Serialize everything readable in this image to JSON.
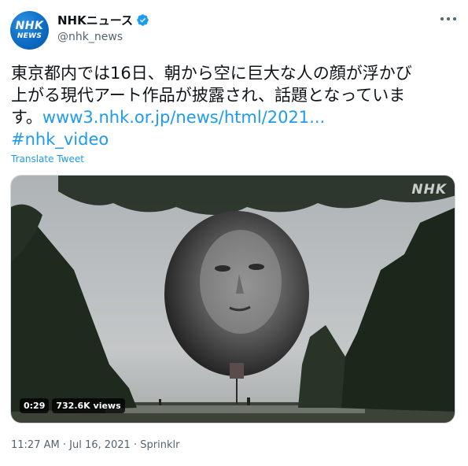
{
  "author": {
    "avatar_line1": "NHK",
    "avatar_line2": "NEWS",
    "display_name": "NHKニュース",
    "handle": "@nhk_news",
    "verified_color": "#1d9bf0"
  },
  "tweet": {
    "lines": [
      "東京都内では16日、朝から空に巨大な人の顔が浮かび",
      "上がる現代アート作品が披露され、話題となっていま",
      "す。"
    ],
    "link_text": "www3.nhk.or.jp/news/html/2021...",
    "hashtag": "#nhk_video",
    "translate_label": "Translate Tweet"
  },
  "video": {
    "watermark": "NHK",
    "duration": "0:29",
    "views": "732.6K views"
  },
  "footer": {
    "time": "11:27 AM",
    "separator1": " · ",
    "date": "Jul 16, 2021",
    "separator2": " · ",
    "source": "Sprinklr"
  },
  "icons": {
    "more": "more-options-icon",
    "verified": "verified-badge-icon"
  },
  "colors": {
    "accent": "#1d9bf0",
    "secondary_text": "#536471",
    "avatar_blue": "#0e6cc4"
  }
}
